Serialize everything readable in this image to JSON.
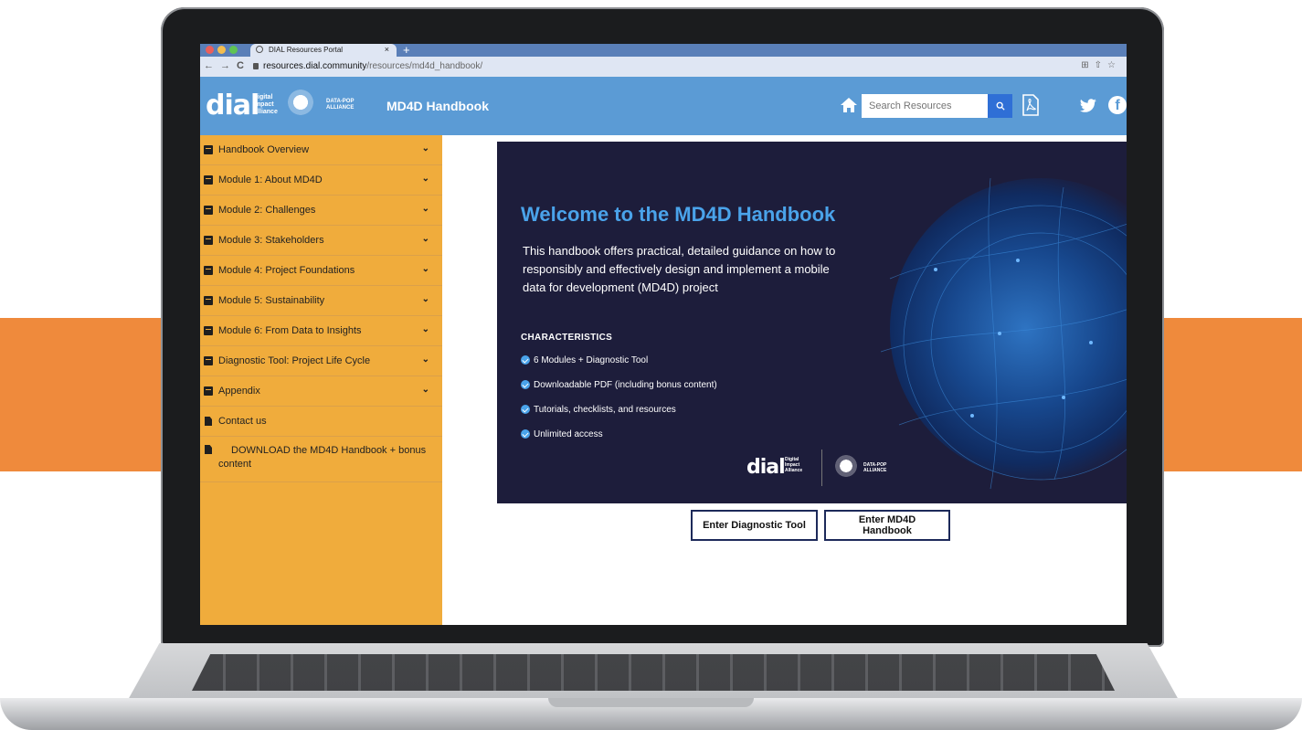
{
  "browser": {
    "tab_title": "DIAL Resources Portal",
    "tab_close": "×",
    "new_tab": "+",
    "nav_back": "←",
    "nav_forward": "→",
    "nav_reload": "C",
    "url_host": "resources.dial.community",
    "url_path": "/resources/md4d_handbook/",
    "traffic_colors": [
      "#ec5f5a",
      "#f4be4f",
      "#5fc454"
    ]
  },
  "header": {
    "logo_text": "dial",
    "logo_sub": [
      "Digital",
      "Impact",
      "Alliance"
    ],
    "partner_logo_text": [
      "DATA-POP",
      "ALLIANCE"
    ],
    "title": "MD4D Handbook",
    "search_placeholder": "Search Resources",
    "bg_color": "#5b9bd5"
  },
  "sidebar": {
    "items": [
      {
        "label": "Handbook Overview",
        "icon": "book-icon",
        "expandable": true
      },
      {
        "label": "Module 1: About MD4D",
        "icon": "book-icon",
        "expandable": true
      },
      {
        "label": "Module 2: Challenges",
        "icon": "book-icon",
        "expandable": true
      },
      {
        "label": "Module 3: Stakeholders",
        "icon": "book-icon",
        "expandable": true
      },
      {
        "label": "Module 4: Project Foundations",
        "icon": "book-icon",
        "expandable": true
      },
      {
        "label": "Module 5: Sustainability",
        "icon": "book-icon",
        "expandable": true
      },
      {
        "label": "Module 6: From Data to Insights",
        "icon": "book-icon",
        "expandable": true
      },
      {
        "label": "Diagnostic Tool: Project Life Cycle",
        "icon": "book-icon",
        "expandable": true
      },
      {
        "label": "Appendix",
        "icon": "book-icon",
        "expandable": true
      },
      {
        "label": "Contact us",
        "icon": "document-icon",
        "expandable": false
      },
      {
        "label": "DOWNLOAD the MD4D Handbook + bonus content",
        "icon": "document-icon",
        "expandable": false
      }
    ],
    "bg_color": "#f0ac3c"
  },
  "hero": {
    "title": "Welcome to the MD4D Handbook",
    "description": "This handbook offers practical, detailed guidance on how to responsibly and effectively design and implement a mobile data for development (MD4D) project",
    "characteristics_heading": "CHARACTERISTICS",
    "characteristics": [
      "6 Modules + Diagnostic Tool",
      "Downloadable PDF (including bonus content)",
      "Tutorials, checklists, and resources",
      "Unlimited access"
    ],
    "footer_logo_text": "dial",
    "footer_logo_sub": [
      "Digital",
      "Impact",
      "Alliance"
    ],
    "footer_partner_text": [
      "DATA-POP",
      "ALLIANCE"
    ],
    "title_color": "#4aa3ea",
    "bg_color": "#1d1d3b"
  },
  "actions": {
    "diagnostic_label": "Enter Diagnostic Tool",
    "handbook_label": "Enter MD4D Handbook"
  },
  "accent": {
    "orange": "#ef8a3c"
  }
}
